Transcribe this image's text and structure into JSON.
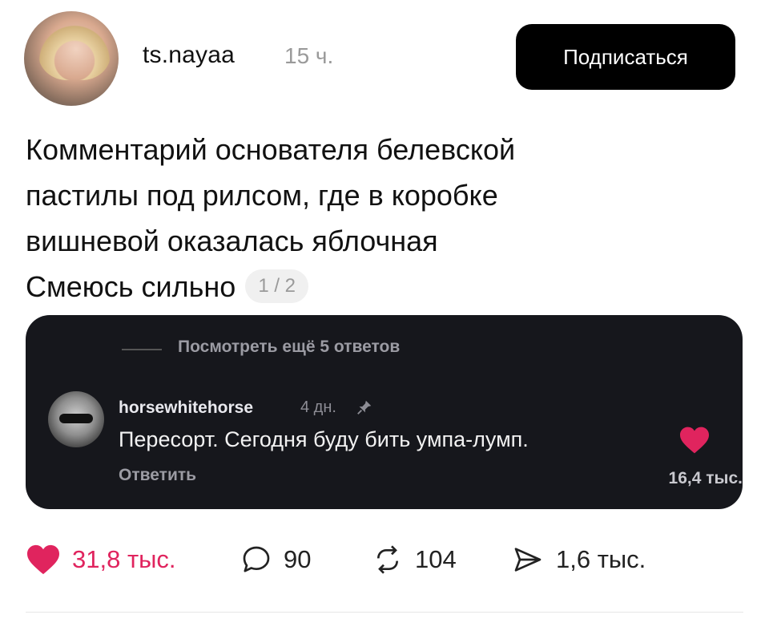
{
  "post": {
    "author": "ts.nayaa",
    "time": "15 ч.",
    "follow_label": "Подписаться",
    "text_lines": [
      "Комментарий основателя белевской",
      "пастилы под рилсом, где в коробке",
      "вишневой оказалась яблочная",
      "Смеюсь сильно"
    ],
    "page_indicator": "1 / 2"
  },
  "comment_card": {
    "more_replies": "Посмотреть ещё 5 ответов",
    "username": "horsewhitehorse",
    "time": "4 дн.",
    "pinned_icon": "pin-icon",
    "text": "Пересорт. Сегодня буду бить умпа-лумп.",
    "reply_label": "Ответить",
    "likes": "16,4 тыс.",
    "heart_color": "#e0245e"
  },
  "actions": {
    "likes": "31,8 тыс.",
    "comments": "90",
    "reposts": "104",
    "shares": "1,6 тыс.",
    "like_color": "#e0245e"
  }
}
